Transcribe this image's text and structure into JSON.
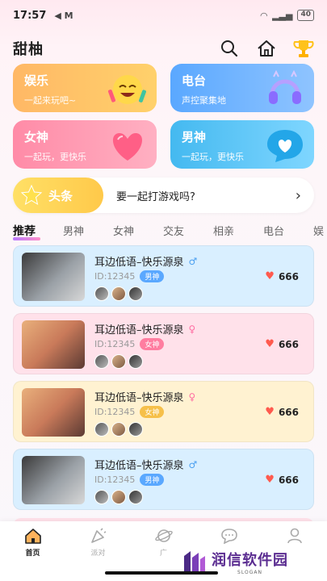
{
  "status_bar": {
    "time": "17:57",
    "battery": "40"
  },
  "header": {
    "brand": "甜柚"
  },
  "categories": [
    {
      "title": "娱乐",
      "subtitle": "一起来玩吧~"
    },
    {
      "title": "电台",
      "subtitle": "声控聚集地"
    },
    {
      "title": "女神",
      "subtitle": "一起玩，更快乐"
    },
    {
      "title": "男神",
      "subtitle": "一起玩，更快乐"
    }
  ],
  "headline": {
    "tag": "头条",
    "text": "要一起打游戏吗?"
  },
  "tabs": [
    "推荐",
    "男神",
    "女神",
    "交友",
    "相亲",
    "电台",
    "娱"
  ],
  "rooms": [
    {
      "name": "耳边低语–快乐源泉",
      "gender": "♂",
      "id": "ID:12345",
      "badge": "男神",
      "likes": "666"
    },
    {
      "name": "耳边低语–快乐源泉",
      "gender": "♀",
      "id": "ID:12345",
      "badge": "女神",
      "likes": "666"
    },
    {
      "name": "耳边低语–快乐源泉",
      "gender": "♀",
      "id": "ID:12345",
      "badge": "女神",
      "likes": "666"
    },
    {
      "name": "耳边低语–快乐源泉",
      "gender": "♂",
      "id": "ID:12345",
      "badge": "男神",
      "likes": "666"
    }
  ],
  "bottom_nav": [
    {
      "label": "首页",
      "icon": "home-icon"
    },
    {
      "label": "派对",
      "icon": "party-icon"
    },
    {
      "label": "广",
      "icon": "planet-icon"
    },
    {
      "label": "",
      "icon": "message-icon"
    },
    {
      "label": "",
      "icon": "profile-icon"
    }
  ],
  "watermark": {
    "title": "润信软件园",
    "sub": "SLOGAN"
  }
}
